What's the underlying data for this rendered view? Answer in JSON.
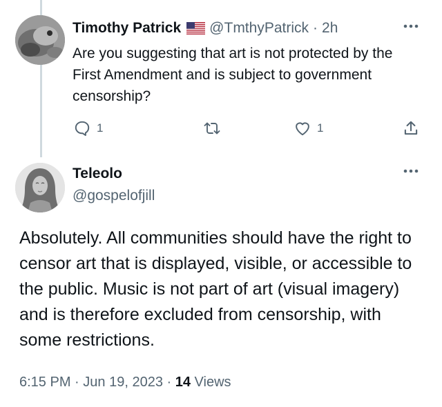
{
  "reply_tweet": {
    "author_name": "Timothy Patrick",
    "flag_icon": "us-flag-icon",
    "handle": "@TmthyPatrick",
    "separator": "·",
    "time_ago": "2h",
    "more_icon": "more-dots-icon",
    "text": "Are you suggesting that art is not protected by the First Amendment and is subject to government censorship?",
    "actions": {
      "reply_icon": "reply-bubble-icon",
      "reply_count": "1",
      "retweet_icon": "retweet-icon",
      "like_icon": "heart-icon",
      "like_count": "1",
      "share_icon": "share-icon"
    }
  },
  "main_tweet": {
    "author_name": "Teleolo",
    "handle": "@gospelofjill",
    "more_icon": "more-dots-icon",
    "text": "Absolutely. All communities should have the right to censor art that is displayed, visible, or accessible to the public. Music is not part of art (visual imagery) and is therefore excluded from censorship, with some restrictions.",
    "time": "6:15 PM",
    "separator": "·",
    "date": "Jun 19, 2023",
    "views_count": "14",
    "views_label": "Views"
  },
  "colors": {
    "text_primary": "#0f1419",
    "text_secondary": "#536471",
    "thread_line": "#cfd9de"
  }
}
